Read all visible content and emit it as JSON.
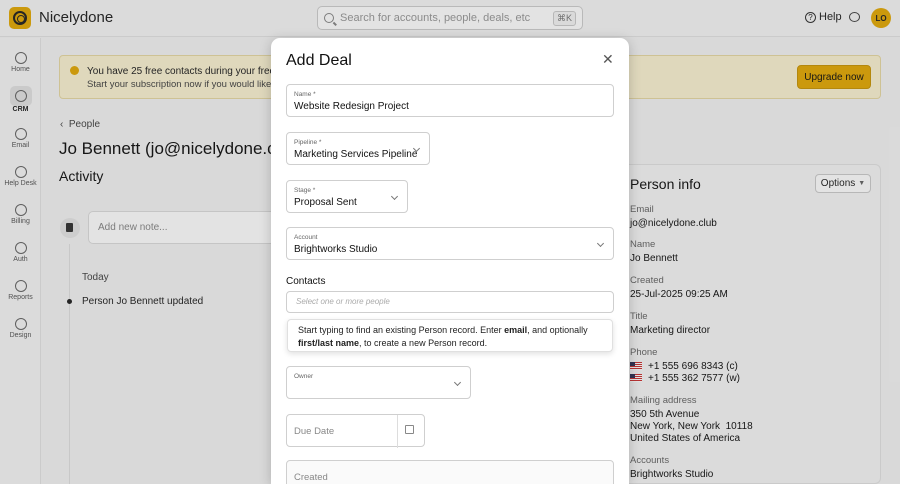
{
  "app": {
    "name": "Nicelydone"
  },
  "search": {
    "placeholder": "Search for accounts, people, deals, etc",
    "shortcut": "⌘K"
  },
  "topbar": {
    "help_label": "Help",
    "avatar_initials": "LO"
  },
  "sidebar": {
    "items": [
      {
        "label": "Home",
        "icon": "home-icon"
      },
      {
        "label": "CRM",
        "icon": "crm-icon",
        "active": true
      },
      {
        "label": "Email",
        "icon": "email-icon"
      },
      {
        "label": "Help Desk",
        "icon": "help-desk-icon"
      },
      {
        "label": "Billing",
        "icon": "billing-icon"
      },
      {
        "label": "Auth",
        "icon": "auth-icon"
      },
      {
        "label": "Reports",
        "icon": "reports-icon"
      },
      {
        "label": "Design",
        "icon": "design-icon"
      }
    ]
  },
  "banner": {
    "line1": "You have 25 free contacts during your free trial",
    "line2": "Start your subscription now if you would like to i",
    "button": "Upgrade now"
  },
  "page": {
    "breadcrumb": "People",
    "title": "Jo Bennett (jo@nicelydone.club)",
    "section": "Activity",
    "note_placeholder": "Add new note...",
    "today_label": "Today",
    "event_text": "Person Jo Bennett updated"
  },
  "person_info": {
    "title": "Person info",
    "options_label": "Options",
    "email_label": "Email",
    "email": "jo@nicelydone.club",
    "name_label": "Name",
    "name": "Jo Bennett",
    "created_label": "Created",
    "created": "25-Jul-2025 09:25 AM",
    "title_label": "Title",
    "job_title": "Marketing director",
    "phone_label": "Phone",
    "phone1": "+1 555 696 8343 (c)",
    "phone2": "+1 555 362 7577 (w)",
    "address_label": "Mailing address",
    "address1": "350 5th Avenue",
    "address2": "New York, New York  10118",
    "address3": "United States of America",
    "accounts_label": "Accounts",
    "account": "Brightworks Studio"
  },
  "modal": {
    "title": "Add Deal",
    "name_label": "Name *",
    "name_value": "Website Redesign Project",
    "pipeline_label": "Pipeline *",
    "pipeline_value": "Marketing Services Pipeline",
    "stage_label": "Stage *",
    "stage_value": "Proposal Sent",
    "account_label": "Account",
    "account_value": "Brightworks Studio",
    "contacts_label": "Contacts",
    "contacts_placeholder": "Select one or more people",
    "hint_part1": "Start typing to find an existing Person record. Enter ",
    "hint_bold1": "email",
    "hint_part2": ", and optionally ",
    "hint_bold2": "first/last name",
    "hint_part3": ", to create a new Person record.",
    "owner_label": "Owner",
    "due_date_placeholder": "Due Date",
    "created_placeholder": "Created"
  },
  "colors": {
    "accent": "#e3a906",
    "banner_bg": "#fbf3d2"
  }
}
